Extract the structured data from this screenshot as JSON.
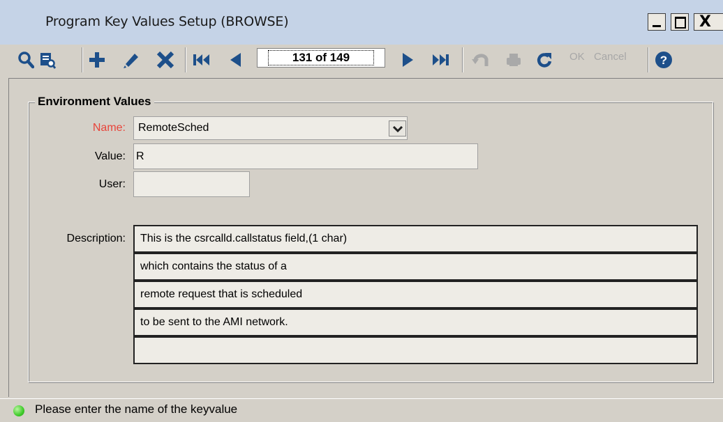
{
  "window": {
    "title": "Program Key Values Setup (BROWSE)",
    "controls": {
      "minimize": "_",
      "maximize": "□",
      "close": "X"
    }
  },
  "toolbar": {
    "icons": [
      "search-icon",
      "preview-icon",
      "add-icon",
      "edit-icon",
      "delete-icon",
      "first-record-icon",
      "previous-record-icon",
      "next-record-icon",
      "last-record-icon",
      "undo-icon",
      "print-icon",
      "refresh-icon",
      "help-icon"
    ],
    "record_position": "131 of 149",
    "ok_label": "OK",
    "cancel_label": "Cancel"
  },
  "form": {
    "group_title": "Environment Values",
    "name_label": "Name:",
    "name_value": "RemoteSched",
    "value_label": "Value:",
    "value_value": "R",
    "user_label": "User:",
    "user_value": "",
    "description_label": "Description:",
    "description_lines": [
      "This is the csrcalld.callstatus field,(1 char)",
      "which contains the status of a",
      "remote request that is scheduled",
      "to be sent to the AMI network.",
      ""
    ]
  },
  "status": {
    "message": "Please enter the name of the keyvalue",
    "indicator_color": "#3fcb2a"
  },
  "colors": {
    "titlebar": "#c5d3e7",
    "window_bg": "#d4d0c8",
    "required_label": "#e8443a",
    "disabled_text": "#a7a7a7"
  }
}
